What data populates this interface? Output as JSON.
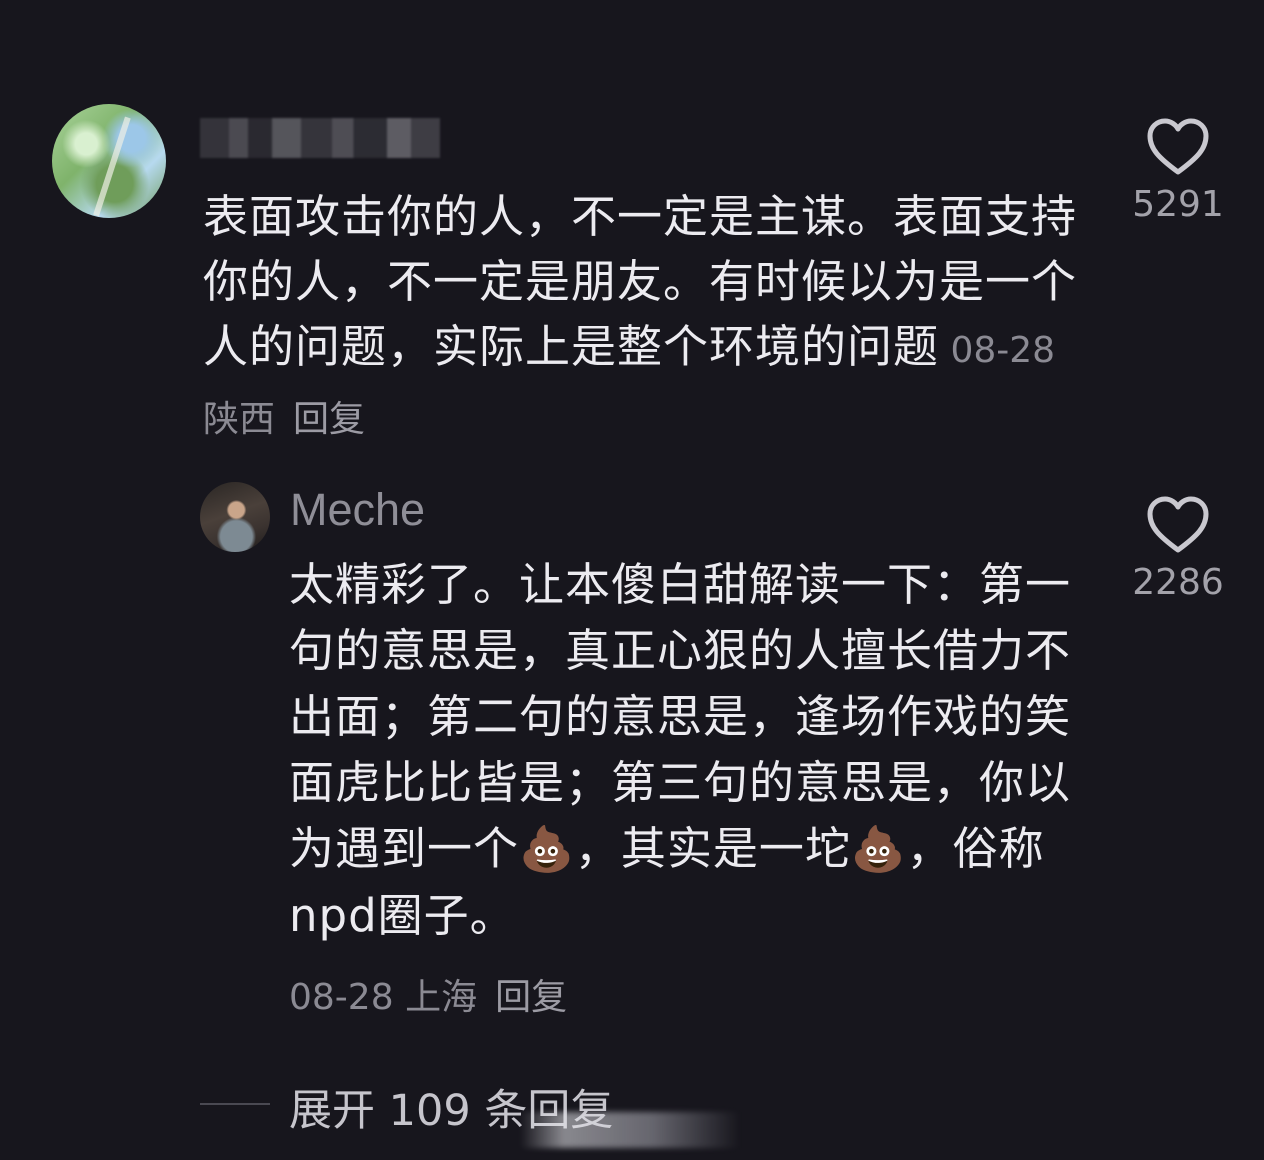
{
  "comment": {
    "text": "表面攻击你的人，不一定是主谋。表面支持你的人，不一定是朋友。有时候以为是一个人的问题，实际上是整个环境的问题",
    "date": "08-28",
    "location": "陕西",
    "reply_label": "回复",
    "likes": "5291"
  },
  "reply": {
    "username": "Meche",
    "text_parts": [
      "太精彩了。让本傻白甜解读一下：第一句的意思是，真正心狠的人擅长借力不出面；第二句的意思是，逢场作戏的笑面虎比比皆是；第三句的意思是，你以为遇到一个",
      "💩",
      "，其实是一坨",
      "💩",
      "，俗称npd圈子。"
    ],
    "date": "08-28",
    "location": "上海",
    "reply_label": "回复",
    "likes": "2286"
  },
  "expand": {
    "label": "展开 109 条回复"
  },
  "icons": {
    "like": "heart-outline-icon",
    "emoji": "pile-of-poo-emoji"
  },
  "colors": {
    "background": "#17161d",
    "text": "#ecebf0",
    "meta": "#8b8a93"
  }
}
